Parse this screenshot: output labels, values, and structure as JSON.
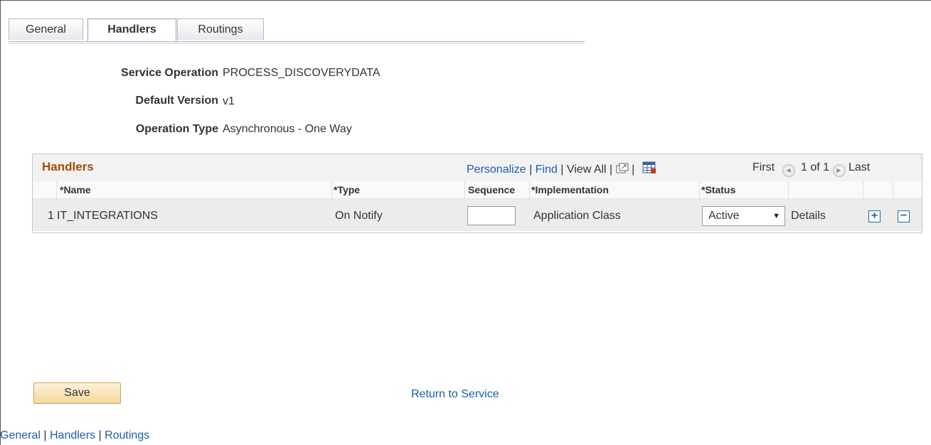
{
  "tabs": [
    "General",
    "Handlers",
    "Routings"
  ],
  "info": {
    "service_operation_label": "Service Operation",
    "service_operation_value": "PROCESS_DISCOVERYDATA",
    "default_version_label": "Default Version",
    "default_version_value": "v1",
    "operation_type_label": "Operation Type",
    "operation_type_value": "Asynchronous - One Way"
  },
  "grid": {
    "title": "Handlers",
    "personalize": "Personalize",
    "find": "Find",
    "view_all": "View All",
    "sep": "|",
    "first": "First",
    "page_count": "1 of 1",
    "last": "Last",
    "columns": {
      "name": "*Name",
      "type": "*Type",
      "sequence": "Sequence",
      "implementation": "*Implementation",
      "status": "*Status"
    },
    "row": {
      "index": "1",
      "name": "IT_INTEGRATIONS",
      "type": "On Notify",
      "sequence": "",
      "implementation": "Application Class",
      "status": "Active",
      "details": "Details",
      "add": "+",
      "remove": "−"
    }
  },
  "actions": {
    "save": "Save",
    "return": "Return to Service"
  },
  "footer_links": [
    "General",
    "Handlers",
    "Routings"
  ],
  "colors": {
    "link": "#1a5fa8",
    "grid_title": "#a34d00",
    "save_bg": "#f6d79e"
  },
  "icons": [
    "new-window-icon",
    "download-grid-icon",
    "previous-arrow-icon",
    "next-arrow-icon",
    "dropdown-arrow-icon"
  ]
}
